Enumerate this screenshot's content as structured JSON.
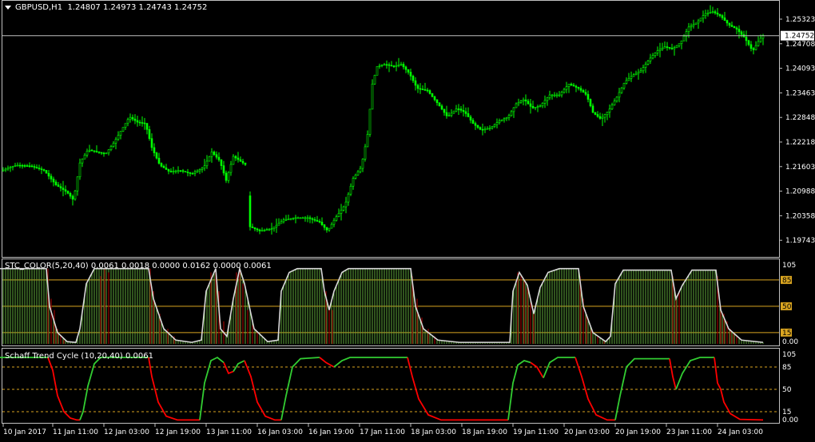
{
  "window": {
    "symbol": "GBPUSD,H1",
    "ohlc": "1.24807 1.24973 1.24743 1.24752"
  },
  "price_axis": {
    "ticks": [
      "1.25323",
      "1.24708",
      "1.24093",
      "1.23463",
      "1.22848",
      "1.22218",
      "1.21603",
      "1.20988",
      "1.20358",
      "1.19743"
    ],
    "current": "1.24752"
  },
  "stc_panel": {
    "title": "STC_COLOR(5,20,40) 0.0061 0.0018 0.0000 0.0162 0.0000 0.0061",
    "axis_ticks": [
      "105",
      "85",
      "50",
      "15",
      "0.00"
    ]
  },
  "schaff_panel": {
    "title": "Schaff Trend Cycle (10,20,40) 0.0061",
    "axis_ticks": [
      "105",
      "85",
      "50",
      "15",
      "0.00"
    ]
  },
  "time_axis": [
    "10 Jan 2017",
    "11 Jan 11:00",
    "12 Jan 03:00",
    "12 Jan 19:00",
    "13 Jan 11:00",
    "16 Jan 03:00",
    "16 Jan 19:00",
    "17 Jan 11:00",
    "18 Jan 03:00",
    "18 Jan 19:00",
    "19 Jan 11:00",
    "20 Jan 03:00",
    "20 Jan 19:00",
    "23 Jan 11:00",
    "24 Jan 03:00"
  ],
  "colors": {
    "background": "#000000",
    "candle": "#00ff00",
    "grid": "#c0c0c0",
    "level": "#daa520",
    "stc_line": "#d9d9d9",
    "histogram_up": "#5fa83c",
    "histogram_down": "#8b0000",
    "schaff_up": "#32cd32",
    "schaff_down": "#ff0000"
  },
  "chart_data": {
    "type": "line",
    "price_path": [
      [
        0,
        1.2166
      ],
      [
        20,
        1.218
      ],
      [
        38,
        1.2178
      ],
      [
        55,
        1.2168
      ],
      [
        70,
        1.2135
      ],
      [
        84,
        1.2118
      ],
      [
        92,
        1.21
      ],
      [
        100,
        1.2185
      ],
      [
        110,
        1.2215
      ],
      [
        122,
        1.221
      ],
      [
        132,
        1.2205
      ],
      [
        142,
        1.223
      ],
      [
        152,
        1.226
      ],
      [
        162,
        1.229
      ],
      [
        172,
        1.2278
      ],
      [
        182,
        1.2275
      ],
      [
        190,
        1.222
      ],
      [
        200,
        1.218
      ],
      [
        212,
        1.2165
      ],
      [
        225,
        1.2168
      ],
      [
        240,
        1.216
      ],
      [
        255,
        1.2175
      ],
      [
        265,
        1.221
      ],
      [
        275,
        1.219
      ],
      [
        283,
        1.2145
      ],
      [
        292,
        1.22
      ],
      [
        300,
        1.219
      ],
      [
        308,
        1.218
      ],
      [
        312,
        1.204
      ],
      [
        325,
        1.203
      ],
      [
        340,
        1.2035
      ],
      [
        355,
        1.2055
      ],
      [
        370,
        1.206
      ],
      [
        385,
        1.206
      ],
      [
        400,
        1.205
      ],
      [
        410,
        1.203
      ],
      [
        420,
        1.206
      ],
      [
        432,
        1.209
      ],
      [
        442,
        1.215
      ],
      [
        452,
        1.2175
      ],
      [
        460,
        1.225
      ],
      [
        466,
        1.2365
      ],
      [
        472,
        1.2405
      ],
      [
        482,
        1.241
      ],
      [
        492,
        1.2405
      ],
      [
        502,
        1.241
      ],
      [
        512,
        1.239
      ],
      [
        522,
        1.2355
      ],
      [
        535,
        1.235
      ],
      [
        548,
        1.232
      ],
      [
        560,
        1.229
      ],
      [
        572,
        1.231
      ],
      [
        582,
        1.23
      ],
      [
        592,
        1.2275
      ],
      [
        602,
        1.226
      ],
      [
        614,
        1.2265
      ],
      [
        624,
        1.228
      ],
      [
        636,
        1.229
      ],
      [
        646,
        1.232
      ],
      [
        656,
        1.233
      ],
      [
        666,
        1.231
      ],
      [
        676,
        1.2315
      ],
      [
        688,
        1.234
      ],
      [
        700,
        1.234
      ],
      [
        712,
        1.2365
      ],
      [
        724,
        1.2355
      ],
      [
        734,
        1.234
      ],
      [
        742,
        1.23
      ],
      [
        752,
        1.2285
      ],
      [
        762,
        1.2305
      ],
      [
        772,
        1.2335
      ],
      [
        782,
        1.237
      ],
      [
        792,
        1.2385
      ],
      [
        802,
        1.2395
      ],
      [
        812,
        1.242
      ],
      [
        822,
        1.244
      ],
      [
        832,
        1.245
      ],
      [
        842,
        1.2445
      ],
      [
        852,
        1.246
      ],
      [
        862,
        1.2495
      ],
      [
        872,
        1.2505
      ],
      [
        882,
        1.2525
      ],
      [
        892,
        1.253
      ],
      [
        902,
        1.252
      ],
      [
        912,
        1.25
      ],
      [
        922,
        1.249
      ],
      [
        932,
        1.247
      ],
      [
        942,
        1.244
      ],
      [
        950,
        1.2465
      ],
      [
        956,
        1.2478
      ]
    ],
    "stc_values": [
      [
        0,
        100
      ],
      [
        58,
        100
      ],
      [
        62,
        50
      ],
      [
        72,
        15
      ],
      [
        84,
        3
      ],
      [
        95,
        2
      ],
      [
        100,
        20
      ],
      [
        108,
        80
      ],
      [
        118,
        100
      ],
      [
        186,
        100
      ],
      [
        192,
        60
      ],
      [
        205,
        20
      ],
      [
        220,
        5
      ],
      [
        240,
        2
      ],
      [
        252,
        5
      ],
      [
        258,
        70
      ],
      [
        270,
        100
      ],
      [
        276,
        20
      ],
      [
        284,
        10
      ],
      [
        292,
        60
      ],
      [
        300,
        100
      ],
      [
        306,
        80
      ],
      [
        318,
        20
      ],
      [
        335,
        3
      ],
      [
        348,
        5
      ],
      [
        352,
        70
      ],
      [
        362,
        95
      ],
      [
        372,
        100
      ],
      [
        402,
        100
      ],
      [
        406,
        70
      ],
      [
        412,
        45
      ],
      [
        418,
        70
      ],
      [
        428,
        95
      ],
      [
        436,
        100
      ],
      [
        514,
        100
      ],
      [
        520,
        50
      ],
      [
        530,
        20
      ],
      [
        548,
        5
      ],
      [
        575,
        2
      ],
      [
        638,
        2
      ],
      [
        642,
        70
      ],
      [
        650,
        95
      ],
      [
        660,
        78
      ],
      [
        668,
        40
      ],
      [
        676,
        75
      ],
      [
        686,
        95
      ],
      [
        700,
        100
      ],
      [
        724,
        100
      ],
      [
        730,
        50
      ],
      [
        742,
        15
      ],
      [
        758,
        3
      ],
      [
        764,
        10
      ],
      [
        770,
        80
      ],
      [
        780,
        98
      ],
      [
        840,
        98
      ],
      [
        846,
        60
      ],
      [
        854,
        78
      ],
      [
        866,
        98
      ],
      [
        896,
        98
      ],
      [
        902,
        45
      ],
      [
        912,
        20
      ],
      [
        928,
        5
      ],
      [
        955,
        2
      ]
    ],
    "stc_histogram_down": [
      [
        60,
        100
      ],
      [
        64,
        60
      ],
      [
        68,
        45
      ],
      [
        72,
        20
      ],
      [
        76,
        12
      ],
      [
        80,
        5
      ],
      [
        126,
        90
      ],
      [
        131,
        100
      ],
      [
        136,
        95
      ],
      [
        188,
        100
      ],
      [
        192,
        70
      ],
      [
        200,
        40
      ],
      [
        210,
        20
      ],
      [
        218,
        10
      ],
      [
        264,
        95
      ],
      [
        270,
        100
      ],
      [
        274,
        70
      ],
      [
        280,
        30
      ],
      [
        296,
        95
      ],
      [
        300,
        100
      ],
      [
        304,
        80
      ],
      [
        310,
        45
      ],
      [
        316,
        25
      ],
      [
        322,
        15
      ],
      [
        408,
        70
      ],
      [
        412,
        50
      ],
      [
        416,
        45
      ],
      [
        516,
        90
      ],
      [
        522,
        60
      ],
      [
        528,
        35
      ],
      [
        536,
        20
      ],
      [
        544,
        10
      ],
      [
        648,
        95
      ],
      [
        652,
        90
      ],
      [
        656,
        85
      ],
      [
        660,
        75
      ],
      [
        664,
        55
      ],
      [
        668,
        40
      ],
      [
        726,
        90
      ],
      [
        730,
        60
      ],
      [
        734,
        40
      ],
      [
        740,
        20
      ],
      [
        748,
        10
      ],
      [
        756,
        5
      ],
      [
        842,
        90
      ],
      [
        846,
        65
      ],
      [
        850,
        70
      ],
      [
        898,
        90
      ],
      [
        902,
        50
      ],
      [
        906,
        40
      ],
      [
        910,
        30
      ],
      [
        914,
        20
      ],
      [
        918,
        15
      ],
      [
        922,
        10
      ]
    ],
    "schaff_segments": [
      {
        "color": "green",
        "points": [
          [
            0,
            100
          ],
          [
            60,
            100
          ]
        ]
      },
      {
        "color": "red",
        "points": [
          [
            60,
            100
          ],
          [
            66,
            80
          ],
          [
            72,
            40
          ],
          [
            80,
            15
          ],
          [
            88,
            5
          ],
          [
            96,
            2
          ],
          [
            100,
            2
          ]
        ]
      },
      {
        "color": "green",
        "points": [
          [
            100,
            2
          ],
          [
            104,
            15
          ],
          [
            110,
            55
          ],
          [
            118,
            90
          ],
          [
            126,
            100
          ],
          [
            186,
            100
          ]
        ]
      },
      {
        "color": "red",
        "points": [
          [
            186,
            100
          ],
          [
            190,
            70
          ],
          [
            198,
            30
          ],
          [
            208,
            8
          ],
          [
            222,
            2
          ],
          [
            250,
            2
          ]
        ]
      },
      {
        "color": "green",
        "points": [
          [
            250,
            2
          ],
          [
            256,
            60
          ],
          [
            264,
            95
          ],
          [
            272,
            100
          ],
          [
            280,
            92
          ]
        ]
      },
      {
        "color": "red",
        "points": [
          [
            280,
            92
          ],
          [
            286,
            75
          ],
          [
            292,
            78
          ]
        ]
      },
      {
        "color": "green",
        "points": [
          [
            292,
            78
          ],
          [
            298,
            90
          ],
          [
            306,
            95
          ]
        ]
      },
      {
        "color": "red",
        "points": [
          [
            306,
            95
          ],
          [
            314,
            70
          ],
          [
            322,
            30
          ],
          [
            332,
            8
          ],
          [
            344,
            2
          ],
          [
            352,
            2
          ]
        ]
      },
      {
        "color": "green",
        "points": [
          [
            352,
            2
          ],
          [
            358,
            40
          ],
          [
            366,
            85
          ],
          [
            376,
            98
          ],
          [
            400,
            100
          ]
        ]
      },
      {
        "color": "red",
        "points": [
          [
            400,
            100
          ],
          [
            408,
            92
          ],
          [
            418,
            85
          ]
        ]
      },
      {
        "color": "green",
        "points": [
          [
            418,
            85
          ],
          [
            428,
            95
          ],
          [
            438,
            100
          ],
          [
            510,
            100
          ]
        ]
      },
      {
        "color": "red",
        "points": [
          [
            510,
            100
          ],
          [
            516,
            70
          ],
          [
            524,
            35
          ],
          [
            536,
            10
          ],
          [
            552,
            2
          ],
          [
            636,
            2
          ]
        ]
      },
      {
        "color": "green",
        "points": [
          [
            636,
            2
          ],
          [
            642,
            60
          ],
          [
            648,
            88
          ],
          [
            656,
            95
          ],
          [
            664,
            92
          ]
        ]
      },
      {
        "color": "red",
        "points": [
          [
            664,
            92
          ],
          [
            672,
            85
          ],
          [
            680,
            68
          ]
        ]
      },
      {
        "color": "green",
        "points": [
          [
            680,
            68
          ],
          [
            688,
            92
          ],
          [
            698,
            100
          ],
          [
            720,
            100
          ]
        ]
      },
      {
        "color": "red",
        "points": [
          [
            720,
            100
          ],
          [
            728,
            70
          ],
          [
            736,
            35
          ],
          [
            746,
            10
          ],
          [
            760,
            2
          ],
          [
            770,
            2
          ]
        ]
      },
      {
        "color": "green",
        "points": [
          [
            770,
            2
          ],
          [
            776,
            40
          ],
          [
            784,
            85
          ],
          [
            794,
            98
          ],
          [
            838,
            98
          ]
        ]
      },
      {
        "color": "red",
        "points": [
          [
            838,
            98
          ],
          [
            842,
            70
          ],
          [
            846,
            50
          ]
        ]
      },
      {
        "color": "green",
        "points": [
          [
            846,
            50
          ],
          [
            854,
            75
          ],
          [
            864,
            95
          ],
          [
            876,
            100
          ],
          [
            894,
            100
          ]
        ]
      },
      {
        "color": "red",
        "points": [
          [
            894,
            100
          ],
          [
            898,
            60
          ],
          [
            902,
            50
          ],
          [
            906,
            30
          ],
          [
            914,
            12
          ],
          [
            926,
            3
          ],
          [
            955,
            2
          ]
        ]
      }
    ]
  }
}
